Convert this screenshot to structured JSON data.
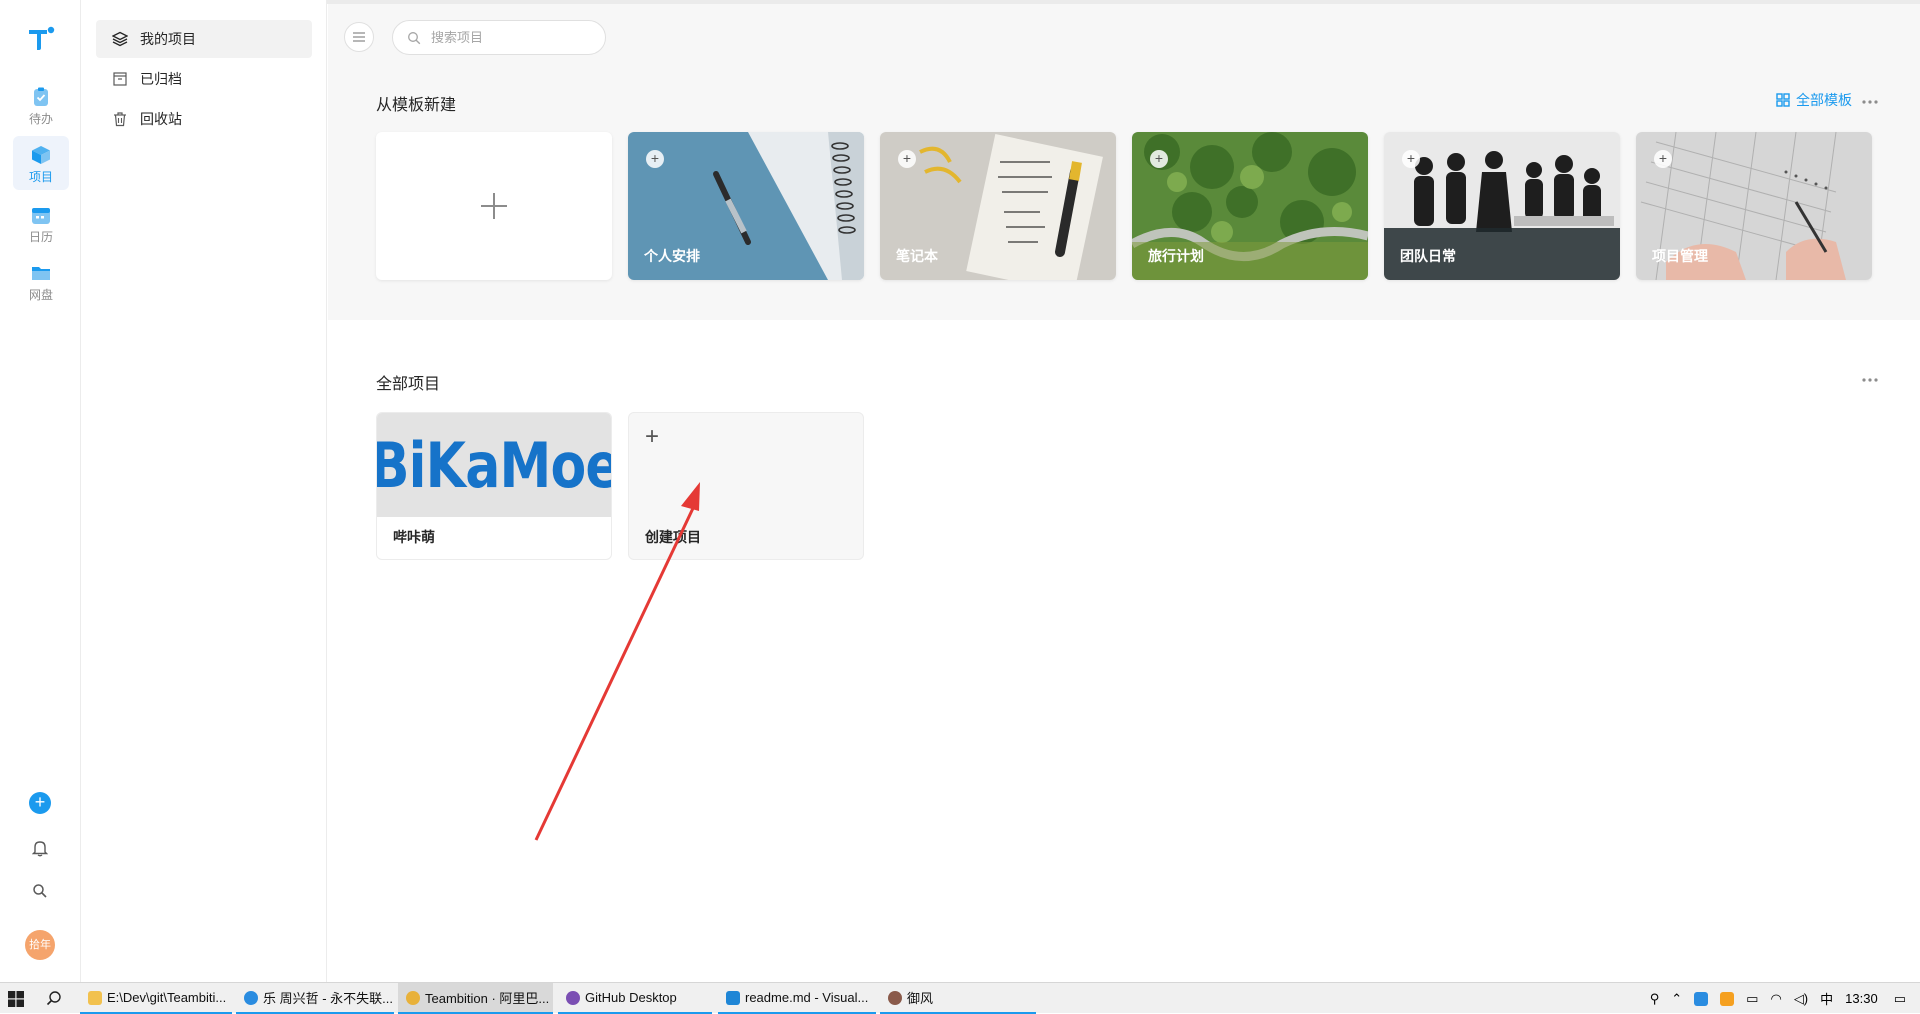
{
  "sidebar": {
    "items": [
      {
        "label": "待办",
        "icon": "todo-icon"
      },
      {
        "label": "项目",
        "icon": "project-icon"
      },
      {
        "label": "日历",
        "icon": "calendar-icon"
      },
      {
        "label": "网盘",
        "icon": "drive-icon"
      }
    ],
    "avatar_text": "拾年"
  },
  "subnav": {
    "items": [
      {
        "label": "我的项目",
        "icon": "layers-icon"
      },
      {
        "label": "已归档",
        "icon": "archive-icon"
      },
      {
        "label": "回收站",
        "icon": "trash-icon"
      }
    ]
  },
  "search": {
    "placeholder": "搜索项目"
  },
  "templates": {
    "title": "从模板新建",
    "all_label": "全部模板",
    "cards": [
      {
        "name": "个人安排"
      },
      {
        "name": "笔记本"
      },
      {
        "name": "旅行计划"
      },
      {
        "name": "团队日常"
      },
      {
        "name": "项目管理"
      }
    ]
  },
  "projects": {
    "title": "全部项目",
    "items": [
      {
        "name": "哔咔萌",
        "cover_text": "BiKaMoe"
      }
    ],
    "create_label": "创建项目"
  },
  "taskbar": {
    "apps": [
      {
        "label": "E:\\Dev\\git\\Teambiti..."
      },
      {
        "label": "乐 周兴哲 - 永不失联..."
      },
      {
        "label": "Teambition · 阿里巴..."
      },
      {
        "label": "GitHub Desktop"
      },
      {
        "label": "readme.md - Visual..."
      },
      {
        "label": "御风"
      }
    ],
    "ime": "中",
    "time": "13:30"
  },
  "colors": {
    "accent": "#1b9aee",
    "arrow": "#e53935",
    "brand_text": "#1673c9"
  }
}
